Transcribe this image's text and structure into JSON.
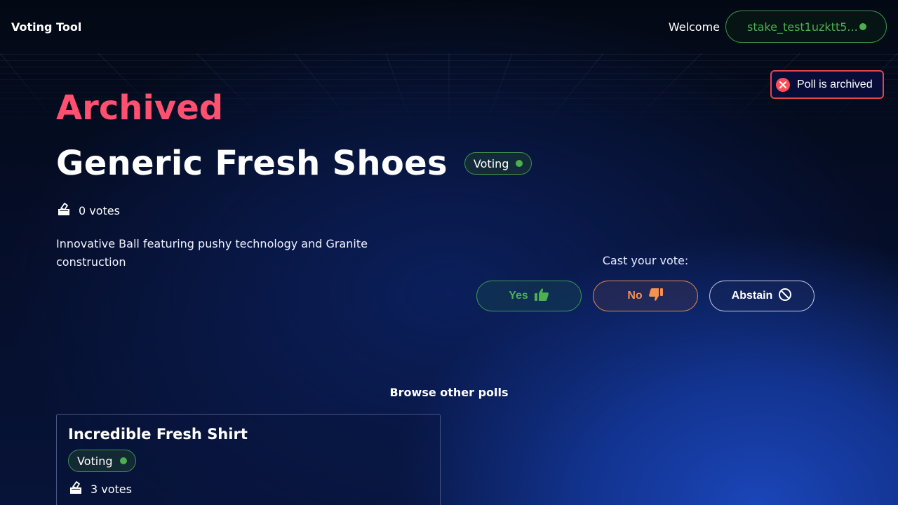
{
  "header": {
    "brand": "Voting Tool",
    "welcome": "Welcome",
    "wallet_address": "stake_test1uzktt5..."
  },
  "toast": {
    "message": "Poll is archived",
    "icon": "x-circle-icon"
  },
  "poll": {
    "state": "Archived",
    "title": "Generic Fresh Shoes",
    "status": "Voting",
    "votes": "0 votes",
    "description": "Innovative Ball featuring pushy technology and Granite construction"
  },
  "vote": {
    "prompt": "Cast your vote:",
    "yes_label": "Yes",
    "no_label": "No",
    "abstain_label": "Abstain"
  },
  "browse": {
    "heading": "Browse other polls",
    "polls": [
      {
        "title": "Incredible Fresh Shirt",
        "status": "Voting",
        "votes": "3 votes"
      }
    ]
  },
  "colors": {
    "archived": "#ff5070",
    "status_green": "#4caf50",
    "no_orange": "#f5924f",
    "toast_border": "#e0474c"
  }
}
